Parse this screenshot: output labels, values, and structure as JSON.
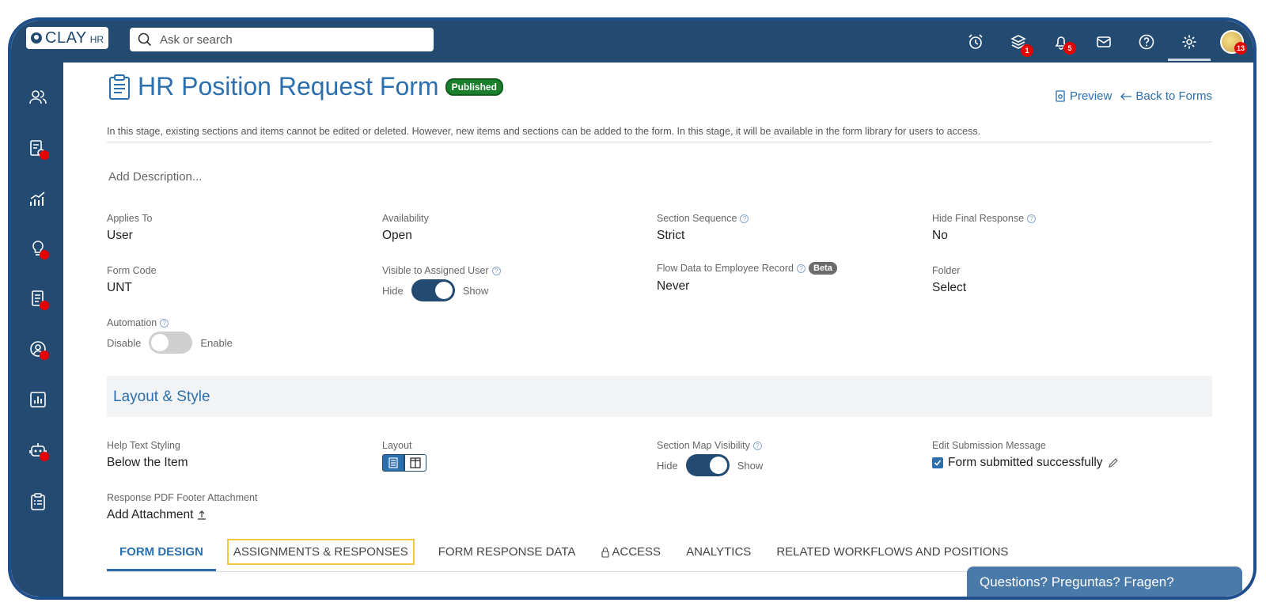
{
  "app": {
    "logo_text": "CLAY",
    "logo_sub": "HR"
  },
  "search": {
    "placeholder": "Ask or search"
  },
  "topbar": {
    "icons": [
      {
        "name": "alarm-clock-icon",
        "badge": ""
      },
      {
        "name": "layers-icon",
        "badge": "1"
      },
      {
        "name": "bell-icon",
        "badge": "5"
      },
      {
        "name": "mail-icon",
        "badge": ""
      },
      {
        "name": "help-icon",
        "badge": ""
      },
      {
        "name": "gear-icon",
        "badge": ""
      }
    ],
    "avatar_badge": "13"
  },
  "colors": {
    "nav": "#234a71",
    "accent": "#2b6fae",
    "published": "#1a7f2a",
    "alert": "#e60000",
    "highlight": "#f2c744"
  },
  "page": {
    "title": "HR Position Request Form",
    "status_badge": "Published",
    "preview_label": "Preview",
    "back_label": "Back to Forms",
    "note": "In this stage, existing sections and items cannot be edited or deleted. However, new items and sections can be added to the form. In this stage, it will be available in the form library for users to access.",
    "add_description": "Add Description..."
  },
  "fields": {
    "applies_to": {
      "label": "Applies To",
      "value": "User"
    },
    "availability": {
      "label": "Availability",
      "value": "Open"
    },
    "section_sequence": {
      "label": "Section Sequence",
      "value": "Strict"
    },
    "hide_final_response": {
      "label": "Hide Final Response",
      "value": "No"
    },
    "form_code": {
      "label": "Form Code",
      "value": "UNT"
    },
    "visible_to_user": {
      "label": "Visible to Assigned User",
      "off": "Hide",
      "on": "Show",
      "state": "on"
    },
    "flow_data": {
      "label": "Flow Data to Employee Record",
      "badge": "Beta",
      "value": "Never"
    },
    "folder": {
      "label": "Folder",
      "value": "Select"
    },
    "automation": {
      "label": "Automation",
      "off": "Disable",
      "on": "Enable",
      "state": "off"
    }
  },
  "layout_style": {
    "title": "Layout & Style",
    "help_text": {
      "label": "Help Text Styling",
      "value": "Below the Item"
    },
    "layout": {
      "label": "Layout",
      "selected": "single-column"
    },
    "section_map": {
      "label": "Section Map Visibility",
      "off": "Hide",
      "on": "Show",
      "state": "on"
    },
    "submission": {
      "label": "Edit Submission Message",
      "value": "Form submitted successfully"
    },
    "pdf_footer": {
      "label": "Response PDF Footer Attachment",
      "value": "Add Attachment"
    }
  },
  "tabs": [
    {
      "label": "FORM DESIGN",
      "active": true
    },
    {
      "label": "ASSIGNMENTS & RESPONSES",
      "highlighted": true
    },
    {
      "label": "FORM RESPONSE DATA"
    },
    {
      "label": "ACCESS",
      "icon": "lock-icon"
    },
    {
      "label": "ANALYTICS"
    },
    {
      "label": "RELATED WORKFLOWS AND POSITIONS"
    }
  ],
  "chat": {
    "label": "Questions? Preguntas? Fragen?"
  },
  "sidebar": [
    {
      "name": "people-icon",
      "dot": false
    },
    {
      "name": "document-check-icon",
      "dot": true
    },
    {
      "name": "trending-chart-icon",
      "dot": false
    },
    {
      "name": "lightbulb-icon",
      "dot": true
    },
    {
      "name": "documents-icon",
      "dot": true
    },
    {
      "name": "person-circle-icon",
      "dot": true
    },
    {
      "name": "bar-chart-icon",
      "dot": false
    },
    {
      "name": "robot-icon",
      "dot": true
    },
    {
      "name": "clipboard-list-icon",
      "dot": false
    }
  ]
}
